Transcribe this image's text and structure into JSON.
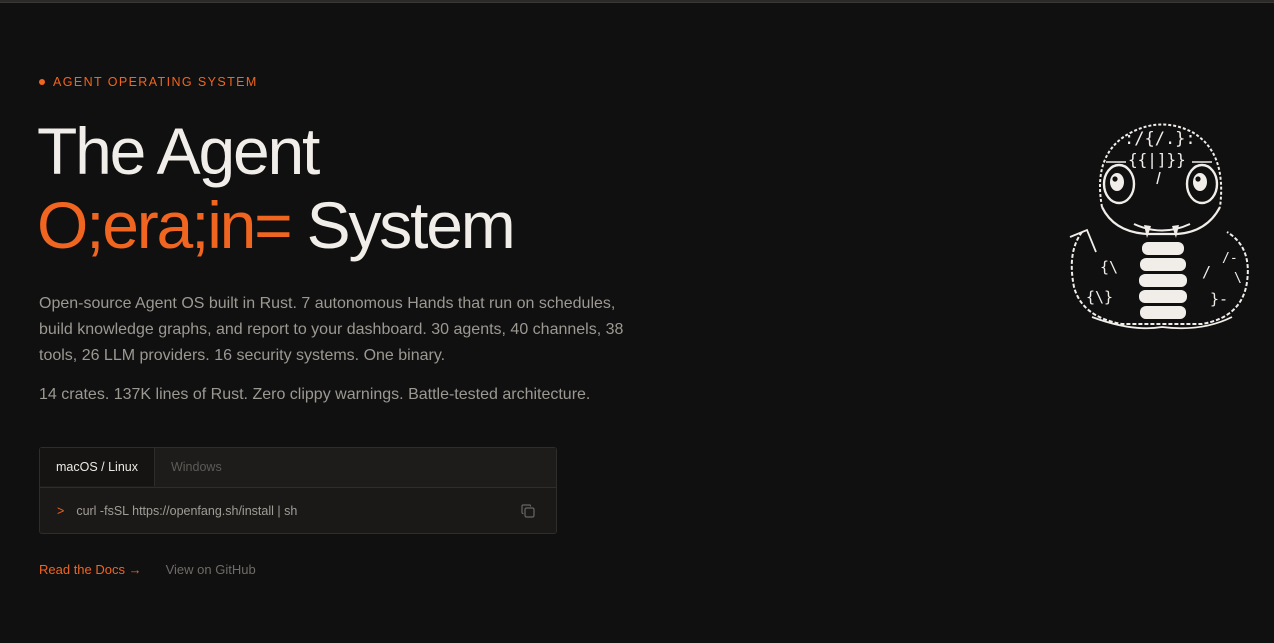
{
  "hero": {
    "eyebrow": "AGENT OPERATING SYSTEM",
    "headline_line1": "The Agent",
    "headline_accent": "O;era;in=",
    "headline_rest": "System",
    "description": "Open-source Agent OS built in Rust. 7 autonomous Hands that run on schedules, build knowledge graphs, and report to your dashboard. 30 agents, 40 channels, 38 tools, 26 LLM providers. 16 security systems. One binary.",
    "stats": "14 crates. 137K lines of Rust. Zero clippy warnings. Battle-tested architecture."
  },
  "install": {
    "tabs": [
      {
        "label": "macOS / Linux",
        "active": true
      },
      {
        "label": "Windows",
        "active": false
      }
    ],
    "prompt": ">",
    "command": "curl -fsSL https://openfang.sh/install | sh",
    "copy_icon": "copy-icon"
  },
  "links": {
    "docs": "Read the Docs →",
    "github": "View on GitHub"
  },
  "mascot": {
    "icon": "ascii-snake-mascot-icon",
    "head_glyphs": ":/{/.}:",
    "head_glyphs_2": "{{|]}}",
    "body_glyphs_left": "{\\}",
    "body_glyphs_right": "}-"
  },
  "colors": {
    "accent": "#f06520",
    "background": "#111010",
    "text": "#ece9e4",
    "muted": "#9c9892"
  }
}
